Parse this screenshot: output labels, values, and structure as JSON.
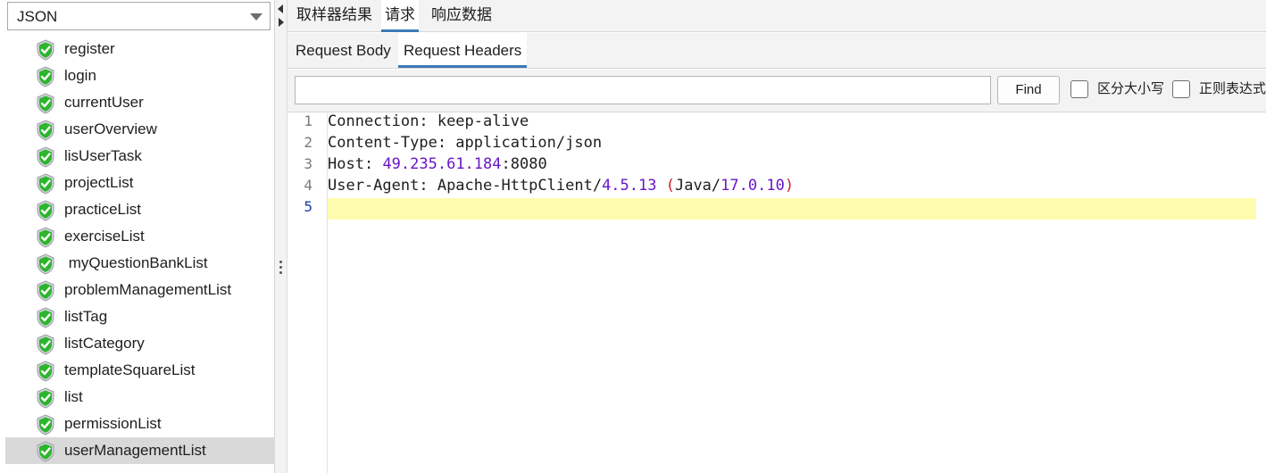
{
  "left_panel": {
    "combo_value": "JSON",
    "tree_items": [
      {
        "label": "register",
        "selected": false
      },
      {
        "label": "login",
        "selected": false
      },
      {
        "label": "currentUser",
        "selected": false
      },
      {
        "label": "userOverview",
        "selected": false
      },
      {
        "label": "lisUserTask",
        "selected": false
      },
      {
        "label": "projectList",
        "selected": false
      },
      {
        "label": "practiceList",
        "selected": false
      },
      {
        "label": "exerciseList",
        "selected": false
      },
      {
        "label": " myQuestionBankList",
        "selected": false
      },
      {
        "label": "problemManagementList",
        "selected": false
      },
      {
        "label": "listTag",
        "selected": false
      },
      {
        "label": "listCategory",
        "selected": false
      },
      {
        "label": "templateSquareList",
        "selected": false
      },
      {
        "label": "list",
        "selected": false
      },
      {
        "label": "permissionList",
        "selected": false
      },
      {
        "label": "userManagementList",
        "selected": true
      }
    ],
    "icon": "green-check-shield-icon"
  },
  "main_tabs": [
    "取样器结果",
    "请求",
    "响应数据"
  ],
  "main_tab_active": "请求",
  "sub_tabs": [
    "Request Body",
    "Request Headers"
  ],
  "sub_tab_active": "Request Headers",
  "find_bar": {
    "input_value": "",
    "find_button": "Find",
    "case_sensitive_label": "区分大小写",
    "regex_label": "正则表达式"
  },
  "editor": {
    "line_numbers": [
      "1",
      "2",
      "3",
      "4",
      "5"
    ],
    "current_line": "5",
    "lines": [
      {
        "key": "Connection:",
        "rest": " keep-alive"
      },
      {
        "key": "Content-Type:",
        "rest": " application/json"
      },
      {
        "key": "Host:",
        "num1": "49.235.61.184",
        "rest": ":8080"
      },
      {
        "key": "User-Agent:",
        "rest": " Apache-HttpClient/",
        "num1": "4.5.13",
        "paren_open": " (",
        "rest2": "Java/",
        "num2": "17.0.10",
        "paren_close": ")"
      },
      {
        "key": "",
        "rest": ""
      }
    ]
  },
  "colors": {
    "accent": "#3d7ab8",
    "highlight_line": "#fdfbae",
    "number": "#6a16c8",
    "paren": "#d0202a",
    "shield_green": "#2db52d"
  }
}
